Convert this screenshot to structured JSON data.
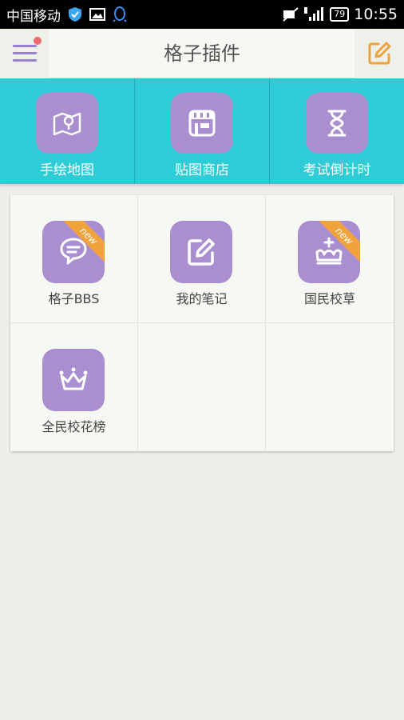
{
  "status_bar": {
    "carrier": "中国移动",
    "battery": "79",
    "time": "10:55"
  },
  "header": {
    "title": "格子插件"
  },
  "tools": [
    {
      "label": "手绘地图",
      "icon": "map-icon"
    },
    {
      "label": "贴图商店",
      "icon": "store-icon"
    },
    {
      "label": "考试倒计时",
      "icon": "hourglass-icon"
    }
  ],
  "grid": [
    {
      "label": "格子BBS",
      "icon": "chat-bubbles-icon",
      "badge": "new"
    },
    {
      "label": "我的笔记",
      "icon": "note-edit-icon",
      "badge": ""
    },
    {
      "label": "国民校草",
      "icon": "royal-crown-icon",
      "badge": "new"
    },
    {
      "label": "全民校花榜",
      "icon": "crown-icon",
      "badge": ""
    }
  ],
  "colors": {
    "accent_cyan": "#2fcbd6",
    "icon_purple": "#a98fcf",
    "badge_orange": "#f0a23b",
    "edit_orange": "#f0a23b",
    "menu_purple": "#9b7fd0",
    "notification_red": "#ef6b72"
  }
}
